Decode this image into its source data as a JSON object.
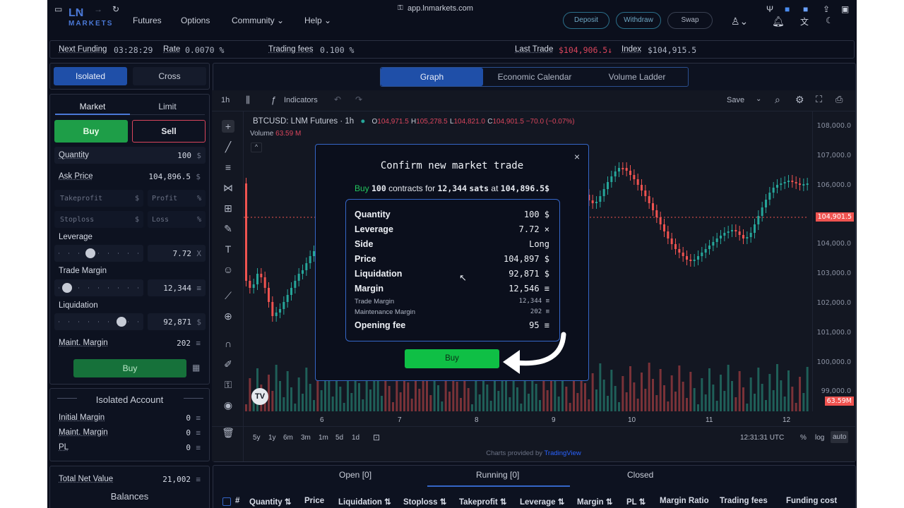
{
  "browser": {
    "url": "app.lnmarkets.com"
  },
  "nav": {
    "logo": "MARKETS",
    "items": [
      "Futures",
      "Options",
      "Community ⌄",
      "Help ⌄"
    ],
    "buttons": [
      "Deposit",
      "Withdraw",
      "Swap"
    ]
  },
  "infobar": {
    "next_funding_label": "Next Funding",
    "next_funding_value": "03:28:29",
    "rate_label": "Rate",
    "rate_value": "0.0070 %",
    "fees_label": "Trading fees",
    "fees_value": "0.100 %",
    "last_trade_label": "Last Trade",
    "last_trade_value": "$104,906.5↓",
    "index_label": "Index",
    "index_value": "$104,915.5"
  },
  "margin_mode": {
    "isolated": "Isolated",
    "cross": "Cross"
  },
  "order": {
    "tab_market": "Market",
    "tab_limit": "Limit",
    "buy": "Buy",
    "sell": "Sell",
    "quantity_label": "Quantity",
    "quantity_value": "100",
    "quantity_unit": "$",
    "ask_label": "Ask Price",
    "ask_value": "104,896.5",
    "ask_unit": "$",
    "takeprofit_placeholder": "Takeprofit",
    "profit_placeholder": "Profit",
    "stoploss_placeholder": "Stoploss",
    "loss_placeholder": "Loss",
    "dollar": "$",
    "percent": "%",
    "leverage_label": "Leverage",
    "leverage_value": "7.72",
    "leverage_unit": "X",
    "trade_margin_label": "Trade Margin",
    "trade_margin_value": "12,344",
    "sat_unit": "≡",
    "liquidation_label": "Liquidation",
    "liquidation_value": "92,871",
    "liquidation_unit": "$",
    "maint_margin_label": "Maint. Margin",
    "maint_margin_value": "202",
    "submit": "Buy"
  },
  "sliders": {
    "leverage": 0.38,
    "trade_margin": 0.05,
    "liquidation": 0.82
  },
  "account": {
    "title": "Isolated Account",
    "initial_margin_label": "Initial Margin",
    "initial_margin_value": "0",
    "maint_margin_label": "Maint. Margin",
    "maint_margin_value": "0",
    "pl_label": "PL",
    "pl_value": "0",
    "total_net_label": "Total Net Value",
    "total_net_value": "21,002",
    "balances_label": "Balances"
  },
  "chart_tabs": [
    "Graph",
    "Economic Calendar",
    "Volume Ladder"
  ],
  "chart_toolbar": {
    "interval": "1h",
    "indicators": "Indicators",
    "save": "Save"
  },
  "chart_header": {
    "symbol": "BTCUSD: LNM Futures · 1h",
    "o_label": "O",
    "o_value": "104,971.5",
    "h_label": "H",
    "h_value": "105,278.5",
    "l_label": "L",
    "l_value": "104,821.0",
    "c_label": "C",
    "c_value": "104,901.5 −70.0 (−0.07%)",
    "volume_label": "Volume",
    "volume_value": "63.59 M"
  },
  "y_ticks": [
    "108,000.0",
    "107,000.0",
    "106,000.0",
    "104,901.5",
    "104,000.0",
    "103,000.0",
    "102,000.0",
    "101,000.0",
    "100,000.0",
    "99,000.0",
    "63.59M"
  ],
  "x_ticks": [
    "6",
    "7",
    "8",
    "9",
    "10",
    "11",
    "12"
  ],
  "ranges": [
    "5y",
    "1y",
    "6m",
    "3m",
    "1m",
    "5d",
    "1d"
  ],
  "chart_footer": {
    "time": "12:31:31 UTC",
    "percent": "%",
    "log": "log",
    "auto": "auto",
    "credit": "Charts provided by",
    "credit_link": "TradingView"
  },
  "modal": {
    "title": "Confirm new market trade",
    "summary_side": "Buy",
    "summary_qty": "100",
    "summary_mid": "contracts for",
    "summary_sats": "12,344",
    "summary_sats_unit": "sats",
    "summary_at": "at",
    "summary_price": "104,896.5$",
    "rows": [
      {
        "k": "Quantity",
        "v": "100 $"
      },
      {
        "k": "Leverage",
        "v": "7.72 ×"
      },
      {
        "k": "Side",
        "v": "Long"
      },
      {
        "k": "Price",
        "v": "104,897 $"
      },
      {
        "k": "Liquidation",
        "v": "92,871 $"
      },
      {
        "k": "Margin",
        "v": "12,546 ≡"
      },
      {
        "k": "Trade Margin",
        "v": "12,344 ≡"
      },
      {
        "k": "Maintenance Margin",
        "v": "202 ≡"
      },
      {
        "k": "Opening fee",
        "v": "95 ≡"
      }
    ],
    "buy_button": "Buy",
    "close": "×"
  },
  "positions_tabs": [
    "Open [0]",
    "Running [0]",
    "Closed"
  ],
  "positions_columns": [
    "#",
    "Quantity ⇅",
    "Price",
    "Liquidation ⇅",
    "Stoploss ⇅",
    "Takeprofit ⇅",
    "Leverage ⇅",
    "Margin ⇅",
    "PL ⇅",
    "Margin Ratio",
    "Trading fees",
    "Funding cost"
  ],
  "colors": {
    "accent_blue": "#1f4fa8",
    "buy_green": "#1e9e48",
    "sell_red": "#d9455c",
    "up_candle": "#26a69a",
    "down_candle": "#ef5350"
  }
}
